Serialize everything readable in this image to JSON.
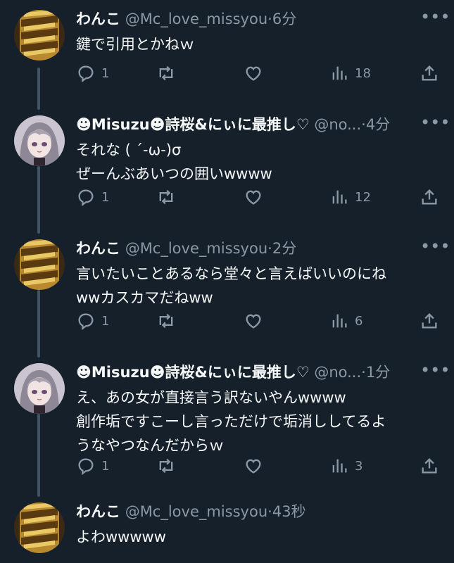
{
  "tweets": [
    {
      "name": "わんこ",
      "handle": "@Mc_love_missyou",
      "time": "6分",
      "lines": [
        "鍵で引用とかねｗ"
      ],
      "replies": "1",
      "retweets": "",
      "likes": "",
      "views": "18",
      "avatar": "dog-avatar"
    },
    {
      "name": "☻Misuzu☻詩桜&にぃに最推し♡",
      "handle": "@no...",
      "time": "4分",
      "lines": [
        "それな ( ´-ω-)σ",
        "ぜーんぶあいつの囲いwwww"
      ],
      "replies": "1",
      "retweets": "",
      "likes": "",
      "views": "12",
      "avatar": "anime-girl-avatar"
    },
    {
      "name": "わんこ",
      "handle": "@Mc_love_missyou",
      "time": "2分",
      "lines": [
        "言いたいことあるなら堂々と言えばいいのにね",
        "wwカスカマだねww"
      ],
      "replies": "1",
      "retweets": "",
      "likes": "",
      "views": "6",
      "avatar": "dog-avatar"
    },
    {
      "name": "☻Misuzu☻詩桜&にぃに最推し♡",
      "handle": "@no...",
      "time": "1分",
      "lines": [
        "え、あの女が直接言う訳ないやんwwww",
        "創作垢ですこーし言っただけで垢消ししてるよ",
        "うなやつなんだからｗ"
      ],
      "replies": "1",
      "retweets": "",
      "likes": "",
      "views": "3",
      "avatar": "anime-girl-avatar"
    },
    {
      "name": "わんこ",
      "handle": "@Mc_love_missyou",
      "time": "43秒",
      "lines": [
        "よわwwwww"
      ],
      "replies": "",
      "retweets": "",
      "likes": "",
      "views": "",
      "avatar": "dog-avatar"
    }
  ],
  "separator": "·",
  "more_glyph": "•••",
  "colors": {
    "background": "#15202b",
    "text": "#f7f9f9",
    "secondary": "#8b98a5",
    "thread_line": "#425364"
  },
  "icons": [
    "reply-icon",
    "retweet-icon",
    "like-icon",
    "views-icon",
    "share-icon",
    "more-icon"
  ]
}
